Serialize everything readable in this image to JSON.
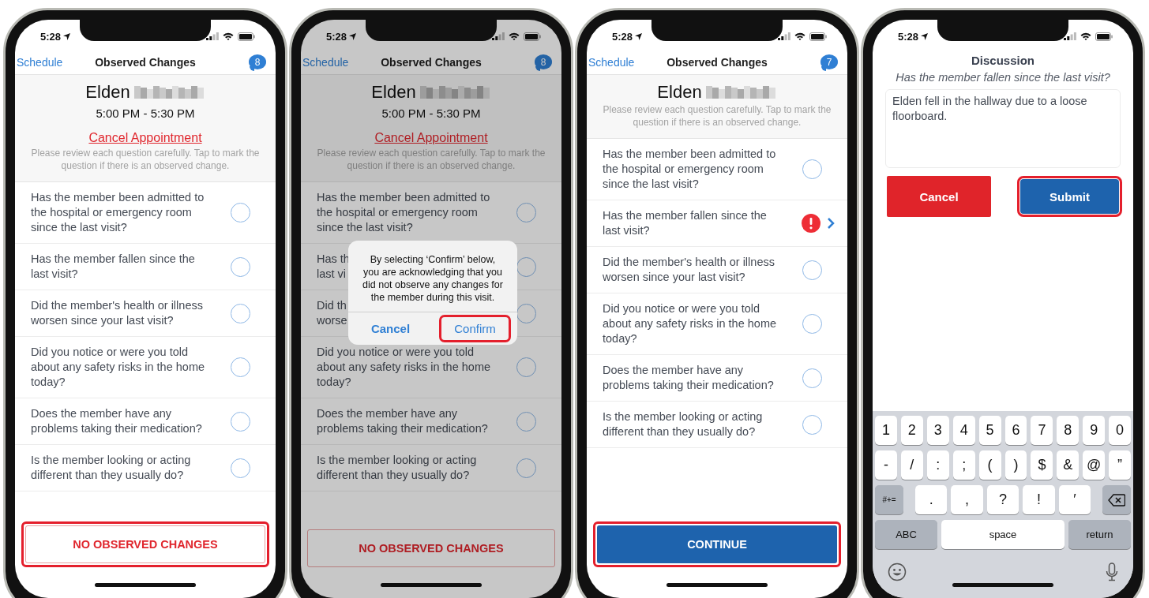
{
  "phones": [
    {
      "kind": "questions",
      "status_time": "5:28",
      "dimmed": false,
      "nav": {
        "back": "Schedule",
        "title": "Observed Changes",
        "badge": "8"
      },
      "header": {
        "name": "Elden",
        "time": "5:00 PM - 5:30 PM",
        "cancel_link": "Cancel Appointment",
        "instructions": "Please review each question carefully. Tap to mark the question if there is an observed change."
      },
      "questions": [
        {
          "lines": [
            "Has the member been admitted to",
            "the hospital or emergency room",
            "since the last visit?"
          ],
          "flagged": false
        },
        {
          "lines": [
            "Has the member fallen since the",
            "last visit?"
          ],
          "flagged": false
        },
        {
          "lines": [
            "Did the member's health or illness",
            "worsen since your last visit?"
          ],
          "flagged": false
        },
        {
          "lines": [
            "Did you notice or were you told",
            "about any safety risks in the home",
            "today?"
          ],
          "flagged": false
        },
        {
          "lines": [
            "Does the member have any",
            "problems taking their medication?"
          ],
          "flagged": false
        },
        {
          "lines": [
            "Is the member looking or acting",
            "different than they usually do?"
          ],
          "flagged": false
        }
      ],
      "action": {
        "kind": "outline",
        "label": "NO OBSERVED CHANGES",
        "highlighted": true
      }
    },
    {
      "kind": "questions",
      "status_time": "5:28",
      "dimmed": true,
      "nav": {
        "back": "Schedule",
        "title": "Observed Changes",
        "badge": "8"
      },
      "header": {
        "name": "Elden",
        "time": "5:00 PM - 5:30 PM",
        "cancel_link": "Cancel Appointment",
        "instructions": "Please review each question carefully. Tap to mark the question if there is an observed change."
      },
      "questions": [
        {
          "lines": [
            "Has the member been admitted to",
            "the hospital or emergency room",
            "since the last visit?"
          ],
          "flagged": false
        },
        {
          "lines": [
            "Has th",
            "last vi"
          ],
          "flagged": false
        },
        {
          "lines": [
            "Did th",
            "worse"
          ],
          "flagged": false
        },
        {
          "lines": [
            "Did you notice or were you told",
            "about any safety risks in the home",
            "today?"
          ],
          "flagged": false
        },
        {
          "lines": [
            "Does the member have any",
            "problems taking their medication?"
          ],
          "flagged": false
        },
        {
          "lines": [
            "Is the member looking or acting",
            "different than they usually do?"
          ],
          "flagged": false
        }
      ],
      "action": {
        "kind": "outline",
        "label": "NO OBSERVED CHANGES",
        "highlighted": false
      },
      "dialog": {
        "message": "By selecting ‘Confirm’ below, you are acknowledging that you did not observe any changes for the member during this visit.",
        "buttons": [
          {
            "kind": "cancel",
            "label": "Cancel",
            "highlighted": false
          },
          {
            "kind": "default",
            "label": "Confirm",
            "highlighted": true
          }
        ]
      }
    },
    {
      "kind": "questions",
      "status_time": "5:28",
      "dimmed": false,
      "nav": {
        "back": "Schedule",
        "title": "Observed Changes",
        "badge": "7"
      },
      "header": {
        "name": "Elden",
        "instructions": "Please review each question carefully. Tap to mark the question if there is an observed change."
      },
      "questions": [
        {
          "lines": [
            "Has the member been admitted to",
            "the hospital or emergency room",
            "since the last visit?"
          ],
          "flagged": false
        },
        {
          "lines": [
            "Has the member fallen since the",
            "last visit?"
          ],
          "flagged": true
        },
        {
          "lines": [
            "Did the member's health or illness",
            "worsen since your last visit?"
          ],
          "flagged": false
        },
        {
          "lines": [
            "Did you notice or were you told",
            "about any safety risks in the home",
            "today?"
          ],
          "flagged": false
        },
        {
          "lines": [
            "Does the member have any",
            "problems taking their medication?"
          ],
          "flagged": false
        },
        {
          "lines": [
            "Is the member looking or acting",
            "different than they usually do?"
          ],
          "flagged": false
        }
      ],
      "action": {
        "kind": "filled",
        "label": "CONTINUE",
        "highlighted": true
      }
    },
    {
      "kind": "discussion",
      "status_time": "5:28",
      "title": "Discussion",
      "question": "Has the member fallen since the last visit?",
      "answer": "Elden fell in the hallway due to a loose floorboard.",
      "buttons": [
        {
          "kind": "danger",
          "label": "Cancel",
          "highlighted": false
        },
        {
          "kind": "primary",
          "label": "Submit",
          "highlighted": true
        }
      ],
      "keyboard": {
        "number_keys": [
          {
            "kind": "char",
            "label": "1"
          },
          {
            "kind": "char",
            "label": "2"
          },
          {
            "kind": "char",
            "label": "3"
          },
          {
            "kind": "char",
            "label": "4"
          },
          {
            "kind": "char",
            "label": "5"
          },
          {
            "kind": "char",
            "label": "6"
          },
          {
            "kind": "char",
            "label": "7"
          },
          {
            "kind": "char",
            "label": "8"
          },
          {
            "kind": "char",
            "label": "9"
          },
          {
            "kind": "char",
            "label": "0"
          }
        ],
        "symbol_keys": [
          {
            "kind": "char",
            "label": "-"
          },
          {
            "kind": "char",
            "label": "/"
          },
          {
            "kind": "char",
            "label": ":"
          },
          {
            "kind": "char",
            "label": ";"
          },
          {
            "kind": "char",
            "label": "("
          },
          {
            "kind": "char",
            "label": ")"
          },
          {
            "kind": "char",
            "label": "$"
          },
          {
            "kind": "char",
            "label": "&"
          },
          {
            "kind": "char",
            "label": "@"
          },
          {
            "kind": "char",
            "label": "”"
          }
        ],
        "punctuation_keys": [
          {
            "kind": "mod",
            "label": "#+="
          },
          {
            "kind": "wide-char",
            "label": "."
          },
          {
            "kind": "wide-char",
            "label": ","
          },
          {
            "kind": "wide-char",
            "label": "?"
          },
          {
            "kind": "wide-char",
            "label": "!"
          },
          {
            "kind": "wide-char",
            "label": "′"
          },
          {
            "kind": "backspace"
          }
        ],
        "bottom_keys": [
          {
            "kind": "wide-mod",
            "label": "ABC"
          },
          {
            "kind": "space",
            "label": "space"
          },
          {
            "kind": "wide-mod",
            "label": "return"
          }
        ]
      }
    }
  ]
}
